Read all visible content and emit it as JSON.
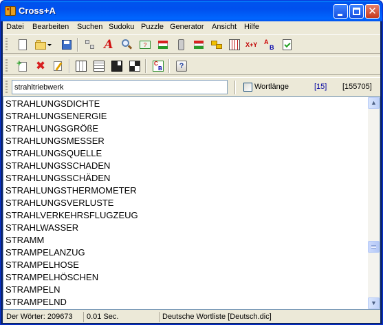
{
  "window": {
    "title": "Cross+A"
  },
  "menu": [
    "Datei",
    "Bearbeiten",
    "Suchen",
    "Sudoku",
    "Puzzle",
    "Generator",
    "Ansicht",
    "Hilfe"
  ],
  "toolbar1": [
    "new-document-icon",
    "open-folder-icon",
    "dropdown-arrow-icon",
    "save-icon",
    "grid-blocks-icon",
    "font-a-icon",
    "magnifier-icon",
    "crossword-question-icon",
    "flag-icon",
    "document-page-icon",
    "flag-arrow-icon",
    "yellow-chain-icon",
    "grid-pattern-icon",
    "x-plus-y-icon",
    "a-to-b-icon",
    "checklist-icon"
  ],
  "toolbar2": [
    "add-icon",
    "delete-icon",
    "edit-icon",
    "sudoku-grid-icon",
    "number-grid-icon",
    "black-square-icon",
    "checkered-icon",
    "abc-grid-icon",
    "help-icon"
  ],
  "toolbar2_labels": {
    "x_plus_y": "X+Y",
    "help": "?"
  },
  "search": {
    "value": "strahltriebwerk",
    "checkbox_label": "Wortlänge",
    "length_count": "[15]",
    "total_count": "[155705]"
  },
  "words": [
    "STRAHLUNGSDICHTE",
    "STRAHLUNGSENERGIE",
    "STRAHLUNGSGRÖßE",
    "STRAHLUNGSMESSER",
    "STRAHLUNGSQUELLE",
    "STRAHLUNGSSCHADEN",
    "STRAHLUNGSSCHÄDEN",
    "STRAHLUNGSTHERMOMETER",
    "STRAHLUNGSVERLUSTE",
    "STRAHLVERKEHRSFLUGZEUG",
    "STRAHLWASSER",
    "STRAMM",
    "STRAMPELANZUG",
    "STRAMPELHOSE",
    "STRAMPELHÖSCHEN",
    "STRAMPELN",
    "STRAMPELND"
  ],
  "status": {
    "word_count": "Der Wörter: 209673",
    "time": "0.01 Sec.",
    "wordlist": "Deutsche Wortliste [Deutsch.dic]"
  },
  "colors": {
    "titlebar": "#0054e3",
    "chrome": "#ece9d8",
    "count_blue": "#0000a0"
  }
}
